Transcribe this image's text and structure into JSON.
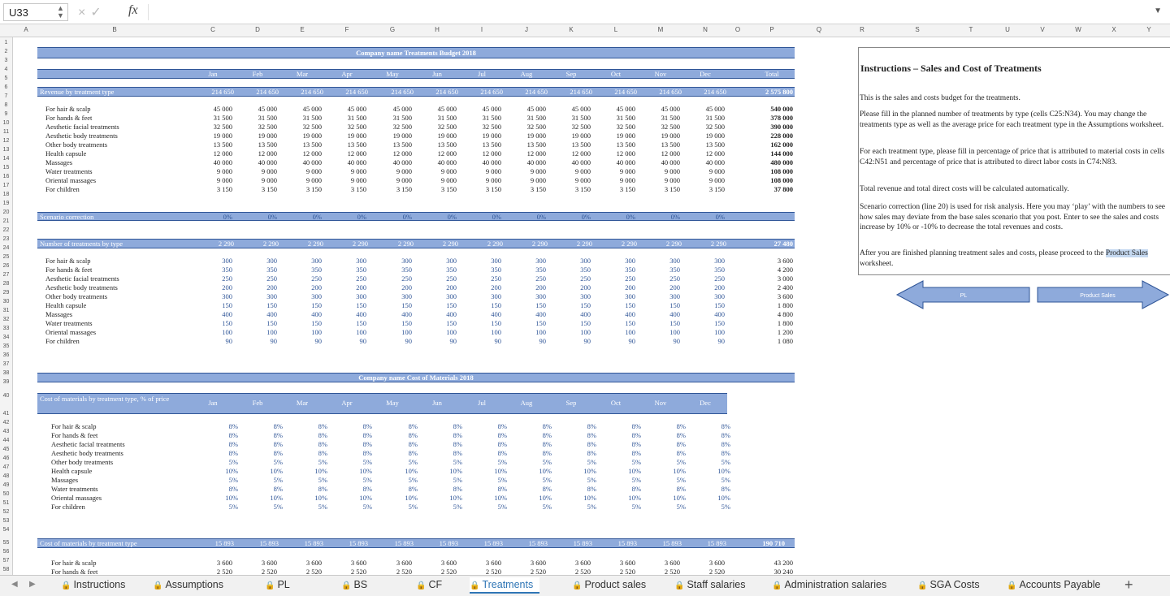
{
  "formula_bar": {
    "cell_ref": "U33",
    "fx": "fx",
    "cancel": "×",
    "confirm": "✓",
    "value": ""
  },
  "columns": [
    "A",
    "B",
    "C",
    "D",
    "E",
    "F",
    "G",
    "H",
    "I",
    "J",
    "K",
    "L",
    "M",
    "N",
    "O",
    "P",
    "Q",
    "R",
    "S",
    "T",
    "U",
    "V",
    "W",
    "X",
    "Y"
  ],
  "rows": [
    "1",
    "2",
    "3",
    "4",
    "5",
    "6",
    "7",
    "8",
    "9",
    "10",
    "11",
    "12",
    "13",
    "14",
    "15",
    "16",
    "17",
    "18",
    "19",
    "20",
    "21",
    "22",
    "23",
    "24",
    "25",
    "26",
    "27",
    "28",
    "29",
    "30",
    "31",
    "32",
    "33",
    "34",
    "35",
    "36",
    "37",
    "38",
    "39",
    "40",
    "41",
    "42",
    "43",
    "44",
    "45",
    "46",
    "47",
    "48",
    "49",
    "50",
    "51",
    "52",
    "53",
    "54",
    "55",
    "56",
    "57",
    "58"
  ],
  "months": [
    "Jan",
    "Feb",
    "Mar",
    "Apr",
    "May",
    "Jun",
    "Jul",
    "Aug",
    "Sep",
    "Oct",
    "Nov",
    "Dec"
  ],
  "total_label": "Total",
  "budget": {
    "title": "Company name Treatments Budget 2018",
    "revenue_header": "Revenue by treatment type",
    "revenue_monthly": "214 650",
    "revenue_total": "2 575 800",
    "lines": [
      {
        "label": "For hair & scalp",
        "value": "45 000",
        "total": "540 000"
      },
      {
        "label": "For hands & feet",
        "value": "31 500",
        "total": "378 000"
      },
      {
        "label": "Aesthetic facial treatments",
        "value": "32 500",
        "total": "390 000"
      },
      {
        "label": "Aesthetic body treatments",
        "value": "19 000",
        "total": "228 000"
      },
      {
        "label": "Other body treatments",
        "value": "13 500",
        "total": "162 000"
      },
      {
        "label": "Health capsule",
        "value": "12 000",
        "total": "144 000"
      },
      {
        "label": "Massages",
        "value": "40 000",
        "total": "480 000"
      },
      {
        "label": "Water treatments",
        "value": "9 000",
        "total": "108 000"
      },
      {
        "label": "Oriental massages",
        "value": "9 000",
        "total": "108 000"
      },
      {
        "label": "For children",
        "value": "3 150",
        "total": "37 800"
      }
    ],
    "scenario_label": "Scenario correction",
    "scenario_value": "0%",
    "count_header": "Number of treatments by type",
    "count_monthly": "2 290",
    "count_total": "27 480",
    "counts": [
      {
        "label": "For hair & scalp",
        "value": "300",
        "total": "3 600"
      },
      {
        "label": "For hands & feet",
        "value": "350",
        "total": "4 200"
      },
      {
        "label": "Aesthetic facial treatments",
        "value": "250",
        "total": "3 000"
      },
      {
        "label": "Aesthetic body treatments",
        "value": "200",
        "total": "2 400"
      },
      {
        "label": "Other body treatments",
        "value": "300",
        "total": "3 600"
      },
      {
        "label": "Health capsule",
        "value": "150",
        "total": "1 800"
      },
      {
        "label": "Massages",
        "value": "400",
        "total": "4 800"
      },
      {
        "label": "Water treatments",
        "value": "150",
        "total": "1 800"
      },
      {
        "label": "Oriental massages",
        "value": "100",
        "total": "1 200"
      },
      {
        "label": "For children",
        "value": "90",
        "total": "1 080"
      }
    ]
  },
  "materials": {
    "title": "Company name Cost of Materials 2018",
    "pct_header": "Cost of materials by treatment type, % of price",
    "pcts": [
      {
        "label": "For hair & scalp",
        "value": "8%"
      },
      {
        "label": "For hands & feet",
        "value": "8%"
      },
      {
        "label": "Aesthetic facial treatments",
        "value": "8%"
      },
      {
        "label": "Aesthetic body treatments",
        "value": "8%"
      },
      {
        "label": "Other body treatments",
        "value": "5%"
      },
      {
        "label": "Health capsule",
        "value": "10%"
      },
      {
        "label": "Massages",
        "value": "5%"
      },
      {
        "label": "Water treatments",
        "value": "8%"
      },
      {
        "label": "Oriental massages",
        "value": "10%"
      },
      {
        "label": "For children",
        "value": "5%"
      }
    ],
    "cost_header": "Cost of materials by treatment type",
    "cost_monthly": "15 893",
    "cost_total": "190 710",
    "cost_lines": [
      {
        "label": "For hair & scalp",
        "value": "3 600",
        "total": "43 200"
      },
      {
        "label": "For hands & feet",
        "value": "2 520",
        "total": "30 240"
      }
    ]
  },
  "instructions": {
    "title": "Instructions – Sales and Cost of Treatments",
    "p1": "This is the sales and costs budget for the treatments.",
    "p2": "Please fill in the planned number of treatments by type (cells C25:N34). You may change the treatments type as well as the average price for each treatment type in the Assumptions worksheet.",
    "p3": "For each treatment type, please fill in percentage of price that is attributed to material costs in cells C42:N51 and percentage of price that is attributed to direct labor costs in C74:N83.",
    "p4": "Total revenue and total direct costs will be calculated automatically.",
    "p5": "Scenario correction (line 20) is used for risk analysis. Here you may ‘play’ with the numbers to see how sales may deviate from the base sales scenario that you post. Enter to see the sales and costs increase by 10% or -10% to decrease the total revenues and costs.",
    "p6_a": "After you are finished planning treatment sales and costs, please proceed to the ",
    "p6_link": "Product Sales",
    "p6_b": " worksheet.",
    "btn_prev": "PL",
    "btn_next": "Product Sales"
  },
  "tabs": [
    {
      "label": "Instructions",
      "locked": true
    },
    {
      "label": "Assumptions",
      "locked": true
    },
    {
      "label": "PL",
      "locked": true
    },
    {
      "label": "BS",
      "locked": true
    },
    {
      "label": "CF",
      "locked": true
    },
    {
      "label": "Treatments",
      "locked": true,
      "active": true
    },
    {
      "label": "Product sales",
      "locked": true
    },
    {
      "label": "Staff salaries",
      "locked": true
    },
    {
      "label": "Administration salaries",
      "locked": true
    },
    {
      "label": "SGA Costs",
      "locked": true
    },
    {
      "label": "Accounts Payable",
      "locked": true
    }
  ],
  "add_sheet": "+",
  "colors": {
    "band": "#8eaadb",
    "band_border": "#2f5597",
    "accent": "#2f75b5",
    "arrow": "#8eaadb"
  }
}
